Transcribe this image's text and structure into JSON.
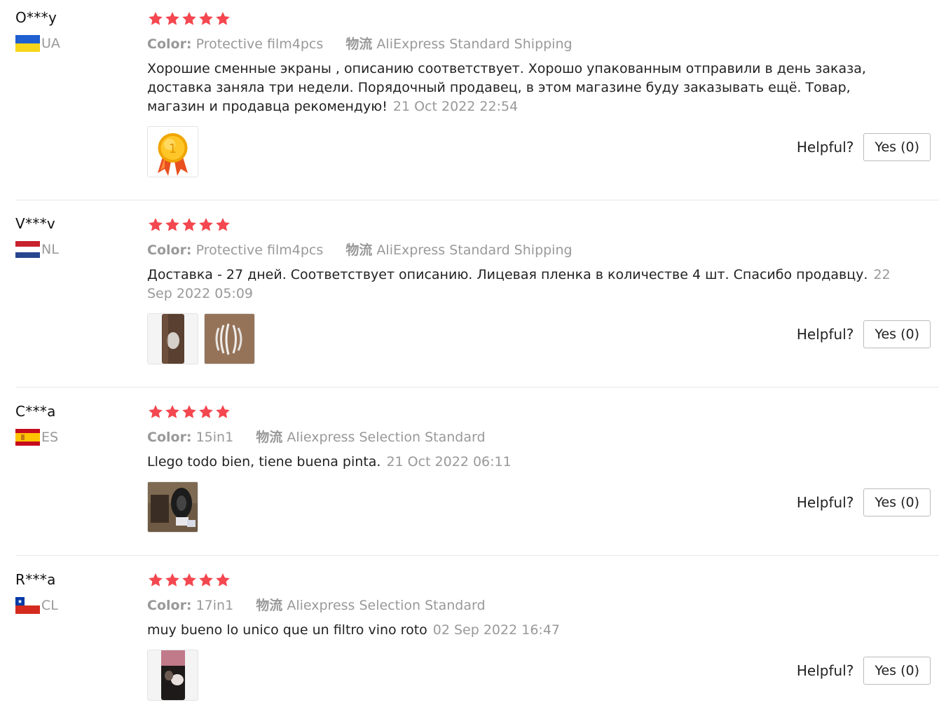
{
  "colors": {
    "star": "#f4474f",
    "muted": "#999999",
    "text": "#222222",
    "separator": "#e8e8e8"
  },
  "reviews": [
    {
      "user": "O***y",
      "country": "UA",
      "rating": 5,
      "color_label": "Color:",
      "color_value": "Protective film4pcs",
      "shipping_label": "物流",
      "shipping_value": "AliExpress Standard Shipping",
      "text": "Хорошие сменные экраны , описанию соответствует. Хорошо упакованным отправили в день заказа, доставка заняла три недели. Порядочный продавец, в этом магазине буду заказывать ещё. Товар, магазин и продавца рекомендую!",
      "date": "21 Oct 2022 22:54",
      "images": [
        "gold-medal-image"
      ],
      "helpful_label": "Helpful?",
      "yes_label": "Yes (0)"
    },
    {
      "user": "V***v",
      "country": "NL",
      "rating": 5,
      "color_label": "Color:",
      "color_value": "Protective film4pcs",
      "shipping_label": "物流",
      "shipping_value": "AliExpress Standard Shipping",
      "text": "Доставка - 27 дней. Соответствует описанию. Лицевая пленка в количестве 4 шт. Спасибо продавцу.",
      "date": "22 Sep 2022 05:09",
      "images": [
        "phone-photo",
        "film-photo"
      ],
      "helpful_label": "Helpful?",
      "yes_label": "Yes (0)"
    },
    {
      "user": "C***a",
      "country": "ES",
      "rating": 5,
      "color_label": "Color:",
      "color_value": "15in1",
      "shipping_label": "物流",
      "shipping_value": "Aliexpress Selection Standard",
      "text": "Llego todo bien, tiene buena pinta.",
      "date": "21 Oct 2022 06:11",
      "images": [
        "package-photo"
      ],
      "helpful_label": "Helpful?",
      "yes_label": "Yes (0)"
    },
    {
      "user": "R***a",
      "country": "CL",
      "rating": 5,
      "color_label": "Color:",
      "color_value": "17in1",
      "shipping_label": "物流",
      "shipping_value": "Aliexpress Selection Standard",
      "text": "muy bueno lo unico que un filtro vino roto",
      "date": "02 Sep 2022 16:47",
      "images": [
        "filters-photo"
      ],
      "helpful_label": "Helpful?",
      "yes_label": "Yes (0)"
    }
  ]
}
